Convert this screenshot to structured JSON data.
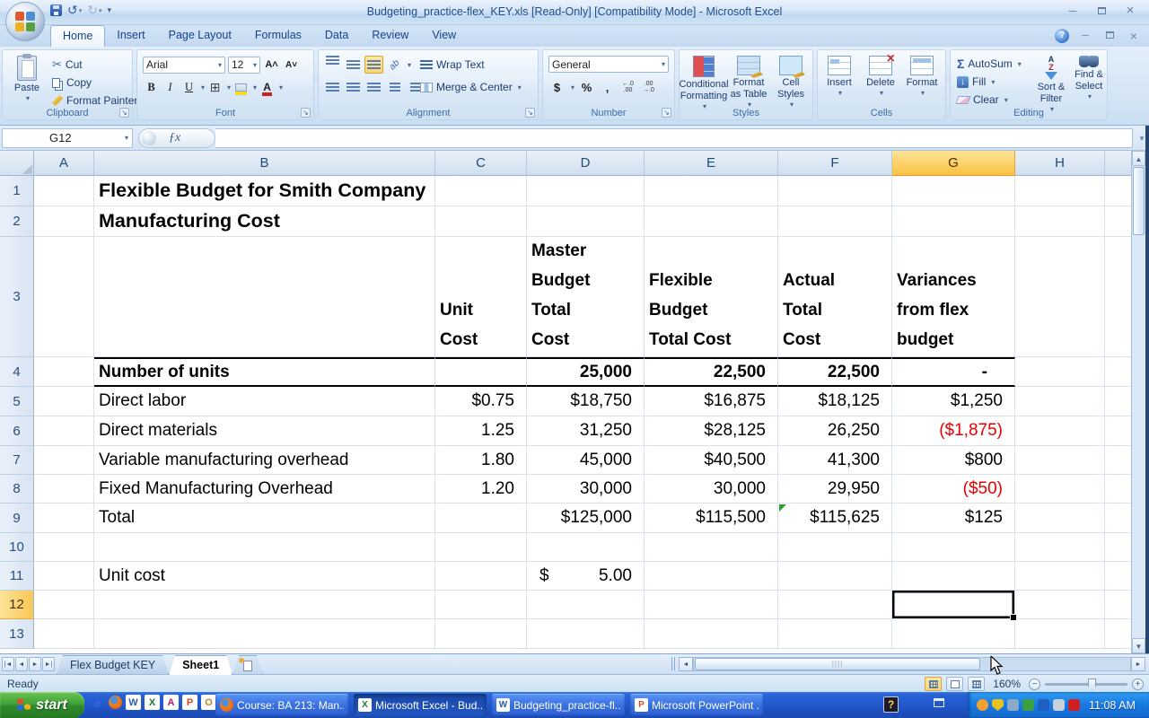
{
  "window": {
    "title": "Budgeting_practice-flex_KEY.xls  [Read-Only]  [Compatibility Mode] - Microsoft Excel"
  },
  "ribbon": {
    "tabs": [
      {
        "label": "Home",
        "active": true
      },
      {
        "label": "Insert"
      },
      {
        "label": "Page Layout"
      },
      {
        "label": "Formulas"
      },
      {
        "label": "Data"
      },
      {
        "label": "Review"
      },
      {
        "label": "View"
      }
    ],
    "clipboard": {
      "group": "Clipboard",
      "paste": "Paste",
      "cut": "Cut",
      "copy": "Copy",
      "format_painter": "Format Painter"
    },
    "font": {
      "group": "Font",
      "name": "Arial",
      "size": "12"
    },
    "alignment": {
      "group": "Alignment",
      "wrap": "Wrap Text",
      "merge": "Merge & Center"
    },
    "number": {
      "group": "Number",
      "format": "General"
    },
    "styles": {
      "group": "Styles",
      "conditional": "Conditional\nFormatting",
      "as_table": "Format\nas Table",
      "cell_styles": "Cell\nStyles"
    },
    "cells": {
      "group": "Cells",
      "insert": "Insert",
      "delete": "Delete",
      "format": "Format"
    },
    "editing": {
      "group": "Editing",
      "autosum": "AutoSum",
      "fill": "Fill",
      "clear": "Clear",
      "sort": "Sort &\nFilter",
      "find": "Find &\nSelect"
    }
  },
  "formula_bar": {
    "name_box": "G12",
    "fx": "ƒx",
    "formula": ""
  },
  "grid": {
    "columns": [
      "A",
      "B",
      "C",
      "D",
      "E",
      "F",
      "G",
      "H"
    ],
    "selected_column": "G",
    "selected_row": 12,
    "active_cell": "G12",
    "rows": [
      {
        "n": 1,
        "cells": [
          {
            "c": "B",
            "t": "Flexible Budget for Smith Company",
            "k": "title"
          }
        ]
      },
      {
        "n": 2,
        "cells": [
          {
            "c": "B",
            "t": "Manufacturing Cost",
            "k": "title"
          }
        ]
      },
      {
        "n": 3,
        "cells": [
          {
            "c": "C",
            "t": "Unit\nCost",
            "k": "head"
          },
          {
            "c": "D",
            "t": "Master\nBudget\nTotal\nCost",
            "k": "head"
          },
          {
            "c": "E",
            "t": "Flexible\nBudget\nTotal Cost",
            "k": "head"
          },
          {
            "c": "F",
            "t": "Actual\nTotal\nCost",
            "k": "head"
          },
          {
            "c": "G",
            "t": "Variances\nfrom flex\nbudget",
            "k": "head"
          }
        ]
      },
      {
        "n": 4,
        "ruled": [
          "B",
          "C",
          "D",
          "E",
          "F",
          "G"
        ],
        "cells": [
          {
            "c": "B",
            "t": "Number of units",
            "k": "labelb"
          },
          {
            "c": "D",
            "t": "25,000",
            "k": "numb"
          },
          {
            "c": "E",
            "t": "22,500",
            "k": "numb"
          },
          {
            "c": "F",
            "t": "22,500",
            "k": "numb"
          },
          {
            "c": "G",
            "t": "-",
            "k": "dash"
          }
        ]
      },
      {
        "n": 5,
        "cells": [
          {
            "c": "B",
            "t": "Direct labor",
            "k": "label"
          },
          {
            "c": "C",
            "t": "$0.75",
            "k": "num"
          },
          {
            "c": "D",
            "t": "$18,750",
            "k": "num"
          },
          {
            "c": "E",
            "t": "$16,875",
            "k": "num"
          },
          {
            "c": "F",
            "t": "$18,125",
            "k": "num"
          },
          {
            "c": "G",
            "t": "$1,250",
            "k": "num"
          }
        ]
      },
      {
        "n": 6,
        "cells": [
          {
            "c": "B",
            "t": "Direct materials",
            "k": "label"
          },
          {
            "c": "C",
            "t": "1.25",
            "k": "num"
          },
          {
            "c": "D",
            "t": "31,250",
            "k": "num"
          },
          {
            "c": "E",
            "t": "$28,125",
            "k": "num"
          },
          {
            "c": "F",
            "t": "26,250",
            "k": "num"
          },
          {
            "c": "G",
            "t": "($1,875)",
            "k": "red"
          }
        ]
      },
      {
        "n": 7,
        "cells": [
          {
            "c": "B",
            "t": "Variable manufacturing overhead",
            "k": "label"
          },
          {
            "c": "C",
            "t": "1.80",
            "k": "num"
          },
          {
            "c": "D",
            "t": "45,000",
            "k": "num"
          },
          {
            "c": "E",
            "t": "$40,500",
            "k": "num"
          },
          {
            "c": "F",
            "t": "41,300",
            "k": "num"
          },
          {
            "c": "G",
            "t": "$800",
            "k": "num"
          }
        ]
      },
      {
        "n": 8,
        "cells": [
          {
            "c": "B",
            "t": "Fixed Manufacturing Overhead",
            "k": "label"
          },
          {
            "c": "C",
            "t": "1.20",
            "k": "num"
          },
          {
            "c": "D",
            "t": "30,000",
            "k": "num"
          },
          {
            "c": "E",
            "t": "30,000",
            "k": "num"
          },
          {
            "c": "F",
            "t": "29,950",
            "k": "num"
          },
          {
            "c": "G",
            "t": "($50)",
            "k": "red"
          }
        ]
      },
      {
        "n": 9,
        "cells": [
          {
            "c": "B",
            "t": "Total",
            "k": "label"
          },
          {
            "c": "D",
            "t": "$125,000",
            "k": "num"
          },
          {
            "c": "E",
            "t": "$115,500",
            "k": "num"
          },
          {
            "c": "F",
            "t": "$115,625",
            "k": "num",
            "flag": true
          },
          {
            "c": "G",
            "t": "$125",
            "k": "num"
          }
        ]
      },
      {
        "n": 10,
        "cells": []
      },
      {
        "n": 11,
        "cells": [
          {
            "c": "B",
            "t": "Unit cost",
            "k": "label"
          },
          {
            "c": "D",
            "t": "5.00",
            "k": "acct",
            "prefix": "$"
          }
        ]
      },
      {
        "n": 12,
        "cells": []
      },
      {
        "n": 13,
        "cells": []
      }
    ]
  },
  "sheet_tabs": {
    "tabs": [
      {
        "label": "Flex Budget KEY"
      },
      {
        "label": "Sheet1",
        "active": true
      }
    ]
  },
  "status_bar": {
    "mode": "Ready",
    "zoom_level": "160%"
  },
  "taskbar": {
    "start_label": "start",
    "quick_launch": [
      "internet-explorer",
      "firefox",
      "word",
      "excel",
      "access",
      "powerpoint",
      "outlook"
    ],
    "buttons": [
      {
        "label": "Course: BA 213: Man...",
        "app": "firefox"
      },
      {
        "label": "Microsoft Excel - Bud...",
        "app": "excel",
        "active": true
      },
      {
        "label": "Budgeting_practice-fl...",
        "app": "word"
      },
      {
        "label": "Microsoft PowerPoint ...",
        "app": "powerpoint"
      }
    ],
    "tray_icons": [
      {
        "name": "messenger",
        "color": "#f0a030"
      },
      {
        "name": "security-shield",
        "color": "#e8c021"
      },
      {
        "name": "network-tool",
        "color": "#8aa8c8"
      },
      {
        "name": "antivirus",
        "color": "#3aa040"
      },
      {
        "name": "zone-alarm",
        "color": "#2060c0"
      },
      {
        "name": "volume",
        "color": "#c8d0da"
      },
      {
        "name": "netware",
        "color": "#d02020"
      }
    ],
    "clock": "11:08 AM"
  },
  "colors": {
    "negative_number": "#e80000",
    "selected_header": "#f9c858",
    "taskbar_blue": "#2258cb",
    "start_green": "#3fa33b",
    "title_text": "#1f4e8c"
  }
}
